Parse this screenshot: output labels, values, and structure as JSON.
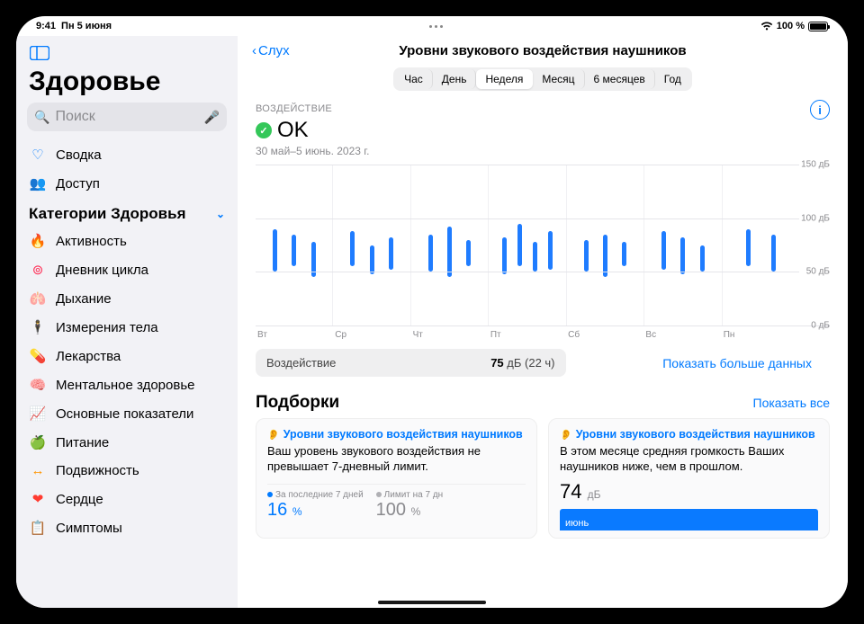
{
  "status": {
    "time": "9:41",
    "date": "Пн 5 июня",
    "battery_pct": "100 %"
  },
  "sidebar": {
    "app_title": "Здоровье",
    "search_placeholder": "Поиск",
    "items_top": [
      {
        "label": "Сводка",
        "icon": "heart-outline"
      },
      {
        "label": "Доступ",
        "icon": "people"
      }
    ],
    "section_header": "Категории Здоровья",
    "categories": [
      {
        "label": "Активность",
        "icon": "flame",
        "color": "#ff3b30"
      },
      {
        "label": "Дневник цикла",
        "icon": "cycle",
        "color": "#ff2d55"
      },
      {
        "label": "Дыхание",
        "icon": "lungs",
        "color": "#5ac8fa"
      },
      {
        "label": "Измерения тела",
        "icon": "body",
        "color": "#af52de"
      },
      {
        "label": "Лекарства",
        "icon": "pills",
        "color": "#5ac8fa"
      },
      {
        "label": "Ментальное здоровье",
        "icon": "brain",
        "color": "#5ac8fa"
      },
      {
        "label": "Основные показатели",
        "icon": "vitals",
        "color": "#ff3b30"
      },
      {
        "label": "Питание",
        "icon": "apple",
        "color": "#34c759"
      },
      {
        "label": "Подвижность",
        "icon": "mobility",
        "color": "#ff9500"
      },
      {
        "label": "Сердце",
        "icon": "heart",
        "color": "#ff3b30"
      },
      {
        "label": "Симптомы",
        "icon": "clipboard",
        "color": "#5e5ce6"
      }
    ]
  },
  "main": {
    "back_label": "Слух",
    "title": "Уровни звукового воздействия наушников",
    "segments": [
      "Час",
      "День",
      "Неделя",
      "Месяц",
      "6 месяцев",
      "Год"
    ],
    "segment_selected": 2,
    "exposure_label": "ВОЗДЕЙСТВИЕ",
    "status_text": "OK",
    "date_range": "30 май–5 июнь. 2023 г.",
    "y_ticks": [
      "150 дБ",
      "100 дБ",
      "50 дБ",
      "0 дБ"
    ],
    "stat_label": "Воздействие",
    "stat_value": "75",
    "stat_unit": "дБ (22 ч)",
    "show_more": "Показать больше данных",
    "highlights_title": "Подборки",
    "show_all": "Показать все",
    "card1": {
      "title": "Уровни звукового воздействия наушников",
      "text": "Ваш уровень звукового воздействия не превышает 7-дневный лимит.",
      "metric1_label": "За последние 7 дней",
      "metric1_value": "16",
      "metric1_unit": "%",
      "metric2_label": "Лимит на 7 дн",
      "metric2_value": "100",
      "metric2_unit": "%"
    },
    "card2": {
      "title": "Уровни звукового воздействия наушников",
      "text": "В этом месяце средняя громкость Ваших наушников ниже, чем в прошлом.",
      "value": "74",
      "unit": "дБ",
      "month": "июнь"
    }
  },
  "chart_data": {
    "type": "range-bar",
    "ylim": [
      0,
      150
    ],
    "ylabel": "дБ",
    "categories": [
      "Вт",
      "Ср",
      "Чт",
      "Пт",
      "Сб",
      "Вс",
      "Пн"
    ],
    "series": [
      {
        "day": 0,
        "bars": [
          {
            "lo": 50,
            "hi": 90
          },
          {
            "lo": 55,
            "hi": 85
          },
          {
            "lo": 45,
            "hi": 78
          }
        ]
      },
      {
        "day": 1,
        "bars": [
          {
            "lo": 55,
            "hi": 88
          },
          {
            "lo": 48,
            "hi": 75
          },
          {
            "lo": 52,
            "hi": 82
          }
        ]
      },
      {
        "day": 2,
        "bars": [
          {
            "lo": 50,
            "hi": 85
          },
          {
            "lo": 45,
            "hi": 92
          },
          {
            "lo": 55,
            "hi": 80
          }
        ]
      },
      {
        "day": 3,
        "bars": [
          {
            "lo": 48,
            "hi": 82
          },
          {
            "lo": 55,
            "hi": 95
          },
          {
            "lo": 50,
            "hi": 78
          },
          {
            "lo": 52,
            "hi": 88
          }
        ]
      },
      {
        "day": 4,
        "bars": [
          {
            "lo": 50,
            "hi": 80
          },
          {
            "lo": 45,
            "hi": 85
          },
          {
            "lo": 55,
            "hi": 78
          }
        ]
      },
      {
        "day": 5,
        "bars": [
          {
            "lo": 52,
            "hi": 88
          },
          {
            "lo": 48,
            "hi": 82
          },
          {
            "lo": 50,
            "hi": 75
          }
        ]
      },
      {
        "day": 6,
        "bars": [
          {
            "lo": 55,
            "hi": 90
          },
          {
            "lo": 50,
            "hi": 85
          }
        ]
      }
    ]
  }
}
